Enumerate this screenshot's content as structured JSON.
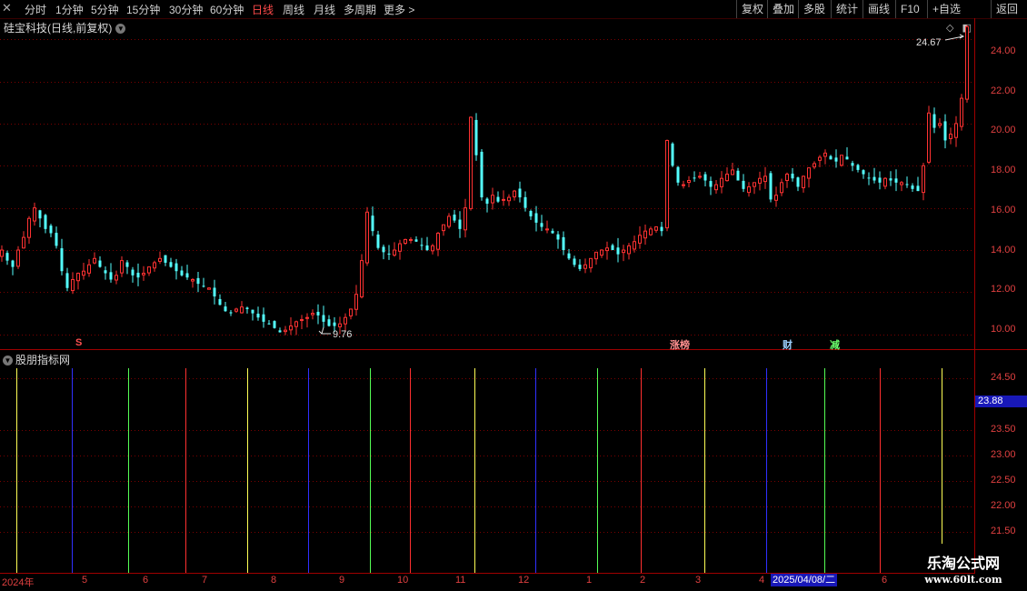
{
  "toolbar": {
    "close_glyph": "✕",
    "periods": [
      "分时",
      "1分钟",
      "5分钟",
      "15分钟",
      "30分钟",
      "60分钟",
      "日线",
      "周线",
      "月线",
      "多周期",
      "更多 >"
    ],
    "active_period": "日线",
    "right_buttons": [
      "复权",
      "叠加",
      "多股",
      "统计",
      "画线",
      "F10",
      "+自选",
      "返回"
    ]
  },
  "chart": {
    "title": "硅宝科技(日线,前复权)",
    "high_label": "24.67",
    "low_label": "9.76",
    "price_axis": [
      "24.00",
      "22.00",
      "20.00",
      "18.00",
      "16.00",
      "14.00",
      "12.00",
      "10.00"
    ],
    "tags": {
      "s": "S",
      "zhangbang": "涨榜",
      "cai": "财",
      "jian": "减"
    }
  },
  "indicator": {
    "title": "股朋指标网",
    "axis": [
      "24.50",
      "23.50",
      "23.00",
      "22.50",
      "22.00",
      "21.50"
    ],
    "current_value": "23.88"
  },
  "date_axis": {
    "labels": [
      "2024年",
      "5",
      "6",
      "7",
      "8",
      "9",
      "10",
      "11",
      "12",
      "1",
      "2",
      "3",
      "4",
      "6"
    ],
    "cursor_date": "2025/04/08/二"
  },
  "watermark": {
    "title": "乐淘公式网",
    "url": "www.60lt.com"
  },
  "colors": {
    "up": "#ff3232",
    "down": "#54ffff",
    "grid": "#7a0000",
    "text": "#d0d0d0",
    "cursor": "#1818b8"
  },
  "icons": {
    "tool_icons": [
      "diamond-icon",
      "window-icon"
    ],
    "expand": "chevron-down-icon"
  },
  "chart_data": {
    "type": "candlestick",
    "ylim": [
      9.3,
      25.0
    ],
    "series": [
      {
        "values": [
          14.0,
          13.5,
          13.2,
          14.0,
          14.6,
          15.5,
          16.0,
          15.5,
          15.0,
          14.8,
          14.2,
          13.0,
          12.2,
          12.6,
          12.9,
          13.0,
          13.3,
          13.6,
          13.2,
          12.9,
          12.6,
          12.8,
          13.5,
          13.2,
          12.8,
          12.7,
          12.9,
          13.2,
          13.4,
          13.6,
          13.4,
          13.2,
          13.0,
          12.8,
          12.7,
          12.6,
          12.4,
          12.3,
          12.2,
          11.8,
          11.4,
          11.1,
          11.0,
          11.2,
          11.3,
          11.2,
          11.0,
          10.8,
          10.6,
          10.5,
          10.3,
          10.1,
          10.2,
          10.4,
          10.6,
          10.7,
          10.8,
          11.0,
          10.9,
          10.6,
          10.4,
          10.4,
          10.5,
          10.8,
          11.2,
          11.9,
          13.5,
          15.8,
          14.9,
          14.1,
          13.9,
          13.8,
          14.0,
          14.3,
          14.5,
          14.5,
          14.4,
          14.2,
          14.0,
          14.2,
          14.8,
          15.2,
          15.6,
          15.4,
          15.0,
          16.0,
          20.3,
          18.5,
          16.5,
          16.2,
          16.6,
          16.3,
          16.4,
          16.5,
          16.8,
          16.5,
          16.0,
          15.6,
          15.3,
          15.1,
          15.0,
          14.8,
          14.5,
          14.0,
          13.6,
          13.3,
          13.1,
          13.3,
          13.6,
          13.9,
          14.0,
          14.1,
          14.0,
          13.8,
          14.0,
          14.2,
          14.4,
          14.7,
          14.9,
          15.0,
          15.1,
          14.9,
          19.2,
          18.0,
          17.2,
          17.1,
          17.3,
          17.4,
          17.5,
          17.3,
          17.0,
          17.1,
          17.4,
          17.6,
          17.8,
          17.3,
          16.9,
          17.0,
          17.2,
          17.4,
          17.5,
          16.4,
          16.6,
          17.2,
          17.6,
          17.4,
          17.0,
          17.5,
          17.9,
          18.1,
          18.4,
          18.6,
          18.3,
          18.2,
          18.5,
          18.3,
          18.0,
          17.8,
          17.6,
          17.4,
          17.3,
          17.2,
          17.4,
          17.3,
          17.2,
          17.2,
          17.1,
          16.9,
          16.8,
          18.0,
          20.5,
          19.8,
          20.0,
          19.2,
          19.5,
          20.0,
          21.2,
          24.6
        ]
      }
    ]
  }
}
